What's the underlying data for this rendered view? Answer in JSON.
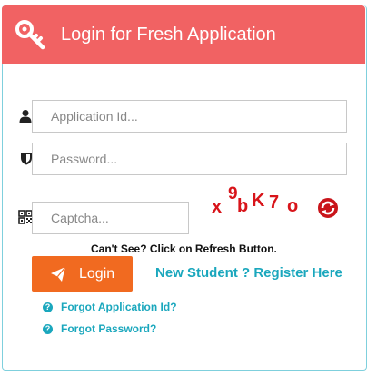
{
  "colors": {
    "header_bg": "#f16263",
    "accent": "#1aa7bd",
    "button": "#f16a20",
    "captcha": "#d8141a"
  },
  "header": {
    "title": "Login for Fresh Application",
    "icon": "key-icon"
  },
  "form": {
    "application_id": {
      "placeholder": "Application Id...",
      "value": "",
      "icon": "user-icon"
    },
    "password": {
      "placeholder": "Password...",
      "value": "",
      "icon": "shield-icon"
    },
    "captcha": {
      "placeholder": "Captcha...",
      "value": "",
      "icon": "qrcode-icon"
    }
  },
  "captcha_image": {
    "chars": [
      "x",
      "9",
      "b",
      "K",
      "7",
      "o"
    ],
    "refresh_icon": "refresh-icon"
  },
  "hint": "Can't See? Click on Refresh Button.",
  "login_button": {
    "label": "Login",
    "icon": "paper-plane-icon"
  },
  "register_link": "New Student ? Register Here",
  "links": [
    {
      "label": "Forgot Application Id?",
      "icon": "question-circle-icon"
    },
    {
      "label": "Forgot Password?",
      "icon": "question-circle-icon"
    }
  ]
}
